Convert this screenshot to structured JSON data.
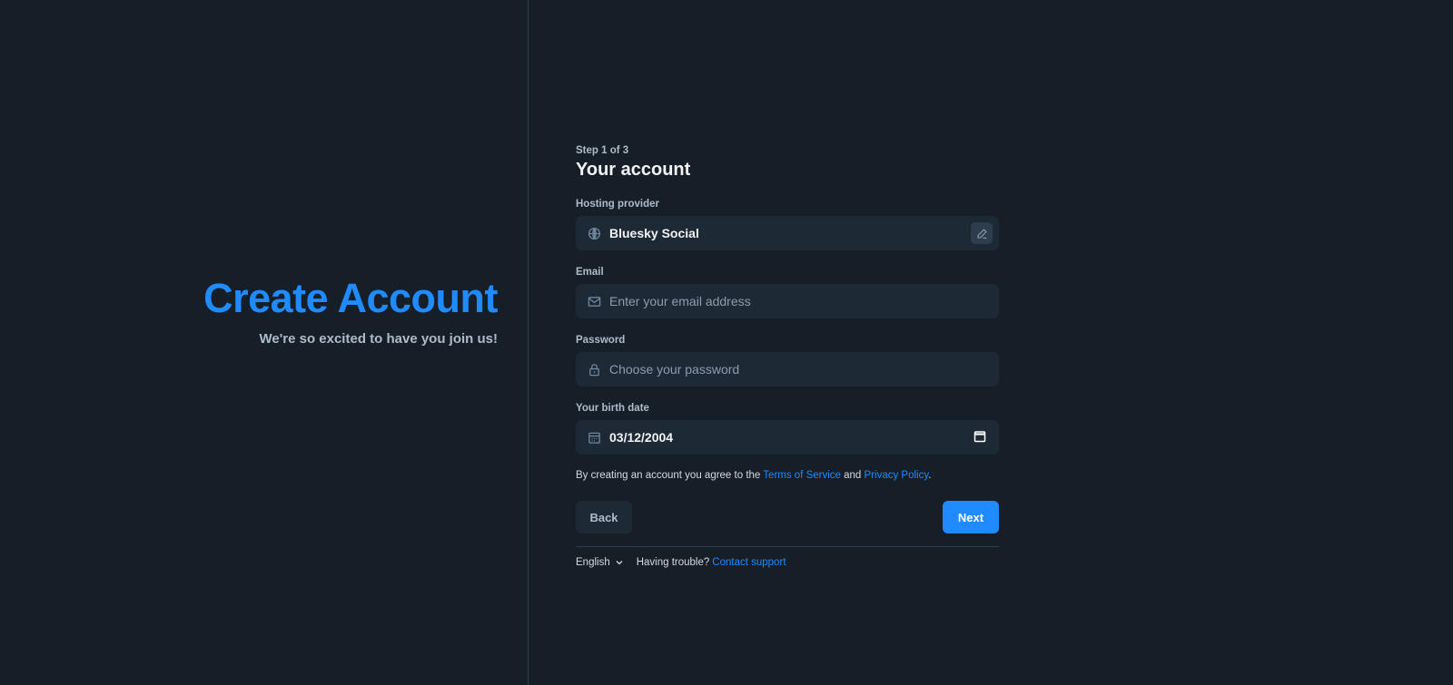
{
  "hero": {
    "title": "Create Account",
    "subtitle": "We're so excited to have you join us!"
  },
  "form": {
    "step": "Step 1 of 3",
    "title": "Your account",
    "hosting": {
      "label": "Hosting provider",
      "value": "Bluesky Social",
      "icon": "globe-icon",
      "edit_icon": "pencil-icon"
    },
    "email": {
      "label": "Email",
      "placeholder": "Enter your email address",
      "value": "",
      "icon": "envelope-icon"
    },
    "password": {
      "label": "Password",
      "placeholder": "Choose your password",
      "value": "",
      "icon": "lock-icon"
    },
    "birthdate": {
      "label": "Your birth date",
      "value": "03/12/2004",
      "icon": "calendar-icon"
    },
    "terms": {
      "prefix": "By creating an account you agree to the ",
      "tos": "Terms of Service",
      "and": " and ",
      "privacy": "Privacy Policy",
      "suffix": "."
    },
    "back_label": "Back",
    "next_label": "Next"
  },
  "footer": {
    "language": "English",
    "trouble": "Having trouble?",
    "support": "Contact support"
  },
  "colors": {
    "accent": "#208bfe",
    "background": "#161e27",
    "field": "#1e2936"
  }
}
